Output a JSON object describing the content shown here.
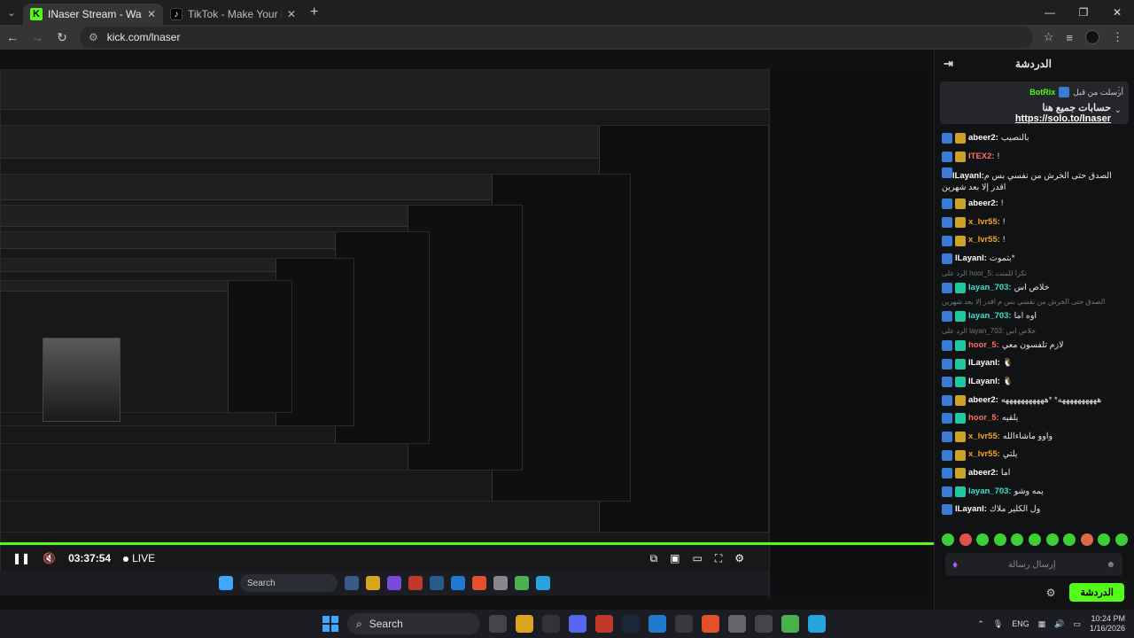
{
  "browser": {
    "tabs": [
      {
        "title": "INaser Stream - Watch Live on",
        "favicon": "kick-icon",
        "active": true
      },
      {
        "title": "TikTok - Make Your Day",
        "favicon": "tiktok-icon",
        "active": false
      }
    ],
    "url": "kick.com/lnaser"
  },
  "player": {
    "time": "03:37:54",
    "live_label": "LIVE"
  },
  "inner_taskbar": {
    "search_placeholder": "Search"
  },
  "chat": {
    "header_title": "الدردشة",
    "pinned": {
      "sent_by_label": "أرسلت من قبل",
      "user": "BotRix",
      "text": "حسابات جميع هنا",
      "link": "https://solo.to/lnaser"
    },
    "messages": [
      {
        "user": "abeer2",
        "text": "بالنصيب",
        "badge": "gold",
        "color": "#ffffff"
      },
      {
        "user": "ITEX2",
        "text": "!",
        "badge": "gold",
        "color": "#ff6b6b"
      },
      {
        "user": "lLayanl",
        "text": "الصدق حتى الخرش من نفسي بس م اقدر إلا بعد شهرين",
        "badge": "none",
        "color": "#ffffff",
        "wrap": true
      },
      {
        "user": "abeer2",
        "text": "!",
        "badge": "gold",
        "color": "#ffffff"
      },
      {
        "user": "x_lvr55",
        "text": "!",
        "badge": "gold",
        "color": "#f5a623"
      },
      {
        "user": "x_lvr55",
        "text": "!",
        "badge": "gold",
        "color": "#f5a623"
      },
      {
        "user": "lLayanl",
        "text": "*بتموت",
        "badge": "none",
        "color": "#ffffff"
      },
      {
        "reply": "الرد على hoor_5: تكرا للمنت"
      },
      {
        "user": "layan_703",
        "text": "خلاص اس",
        "badge": "sub",
        "color": "#40e0d0"
      },
      {
        "reply": "الصدق حتى الخرش من نفسي بس م اقدر إلا بعد شهرين"
      },
      {
        "user": "layan_703",
        "text": "اوه اما",
        "badge": "sub",
        "color": "#40e0d0"
      },
      {
        "reply": "الرد على layan_703: خلاص اس"
      },
      {
        "user": "hoor_5",
        "text": "لازم تلفسون معي",
        "badge": "sub",
        "color": "#ff6b6b"
      },
      {
        "user": "lLayanl",
        "text": "🐧",
        "badge": "sub",
        "color": "#ffffff"
      },
      {
        "user": "lLayanl",
        "text": "🐧",
        "badge": "sub",
        "color": "#ffffff"
      },
      {
        "user": "abeer2",
        "text": "ههههههههههه* *هههههههههههه",
        "badge": "gold",
        "color": "#ffffff"
      },
      {
        "user": "hoor_5",
        "text": "يلقيه",
        "badge": "sub",
        "color": "#ff6b6b"
      },
      {
        "user": "x_lvr55",
        "text": "واوو ماشاءالله",
        "badge": "gold",
        "color": "#f5a623"
      },
      {
        "user": "x_lvr55",
        "text": "يلتي",
        "badge": "gold",
        "color": "#f5a623"
      },
      {
        "user": "abeer2",
        "text": "اما",
        "badge": "gold",
        "color": "#ffffff"
      },
      {
        "user": "layan_703",
        "text": "يمه وشو",
        "badge": "sub",
        "color": "#40e0d0"
      },
      {
        "user": "lLayanl",
        "text": "ول الكلير ملاك",
        "badge": "none",
        "color": "#ffffff"
      }
    ],
    "input_placeholder": "إرسال رسالة",
    "send_label": "الدردشة"
  },
  "taskbar": {
    "search_label": "Search",
    "lang": "ENG",
    "time": "10:24 PM",
    "date": "1/16/2026"
  },
  "colors": {
    "kick_green": "#53fc18",
    "chat_bg": "#111213",
    "taskbar_bg": "#1c1d22"
  }
}
